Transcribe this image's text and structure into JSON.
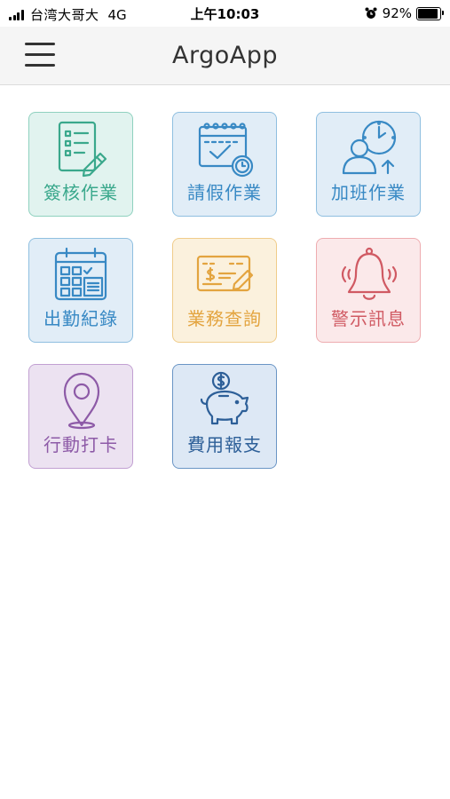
{
  "status_bar": {
    "carrier": "台湾大哥大",
    "network": "4G",
    "time": "上午10:03",
    "battery_percent": "92%",
    "battery_level": 0.92
  },
  "header": {
    "title": "ArgoApp"
  },
  "tiles": [
    {
      "label": "簽核作業",
      "icon": "document-checklist-edit-icon",
      "color": "#3aa88c"
    },
    {
      "label": "請假作業",
      "icon": "calendar-check-clock-icon",
      "color": "#3889c4"
    },
    {
      "label": "加班作業",
      "icon": "user-clock-up-icon",
      "color": "#3889c4"
    },
    {
      "label": "出勤紀錄",
      "icon": "calendar-grid-icon",
      "color": "#3889c4"
    },
    {
      "label": "業務查詢",
      "icon": "cheque-pen-icon",
      "color": "#e3a43f"
    },
    {
      "label": "警示訊息",
      "icon": "ringing-bell-icon",
      "color": "#d05a63"
    },
    {
      "label": "行動打卡",
      "icon": "location-pin-icon",
      "color": "#8d5aa7"
    },
    {
      "label": "費用報支",
      "icon": "piggy-bank-coin-icon",
      "color": "#2d5f98"
    }
  ]
}
